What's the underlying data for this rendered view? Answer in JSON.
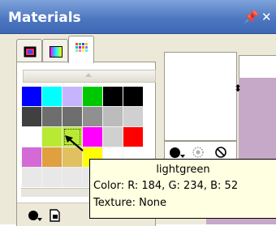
{
  "panel": {
    "title": "Materials",
    "pin_glyph": "p",
    "close_glyph": "×",
    "titlebar_color": "#4f78c2"
  },
  "tabs": [
    {
      "name": "frame-tab-icon",
      "active": false
    },
    {
      "name": "gradient-tab-icon",
      "active": false
    },
    {
      "name": "swatches-tab-icon",
      "active": true
    }
  ],
  "swatches": [
    "#0000ff",
    "#00ffff",
    "#c6b4ff",
    "#00c800",
    "#000000",
    "#000000",
    "#404040",
    "#6e6e6e",
    "#6e6e6e",
    "#909090",
    "#bcbcbc",
    "#d0d0d0",
    "#ffffff",
    "#b8ea34",
    "#b8ea34",
    "#ff00ff",
    "#d0d0d0",
    "#ff0000",
    "#d46ad6",
    "#e0a040",
    "#e0c060",
    "#ffff00",
    "#ffffff",
    "#ffffff",
    "#e8e8e8",
    "#e8e8e8",
    "#e8e8e8",
    "#e8e8e8",
    "#ffffff",
    "#ffffff"
  ],
  "selected_swatch_index": 14,
  "right": {
    "foreground_color": "#ffffff",
    "background_color": "#ffffff",
    "accent_color": "#c6a8c8"
  },
  "tooltip": {
    "name": "lightgreen",
    "color_line": "Color: R: 184, G: 234, B: 52",
    "texture_line": "Texture: None"
  }
}
